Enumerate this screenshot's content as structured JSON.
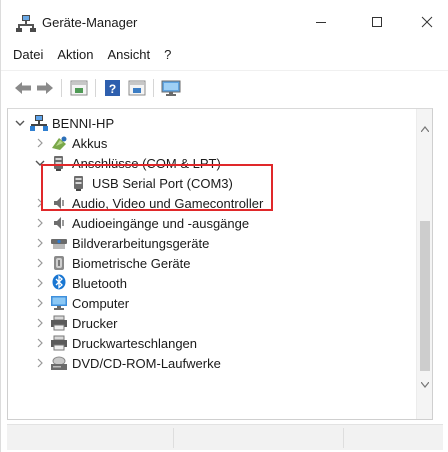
{
  "window": {
    "title": "Geräte-Manager",
    "icons": {
      "app": "device-manager-icon",
      "minimize": "minimize-icon",
      "maximize": "maximize-icon",
      "close": "close-icon"
    }
  },
  "menu": {
    "items": [
      "Datei",
      "Aktion",
      "Ansicht",
      "?"
    ]
  },
  "toolbar": {
    "buttons": [
      "back-arrow-icon",
      "forward-arrow-icon",
      "properties-icon",
      "help-icon",
      "update-driver-icon",
      "scan-hardware-icon"
    ]
  },
  "tree": {
    "root": {
      "label": "BENNI-HP",
      "expanded": true,
      "icon": "computer-icon"
    },
    "items": [
      {
        "label": "Akkus",
        "icon": "battery-icon",
        "expanded": false
      },
      {
        "label": "Anschlüsse (COM & LPT)",
        "icon": "port-icon",
        "expanded": true,
        "children": [
          {
            "label": "USB Serial Port (COM3)",
            "icon": "port-icon"
          }
        ]
      },
      {
        "label": "Audio, Video und Gamecontroller",
        "icon": "speaker-icon",
        "expanded": false
      },
      {
        "label": "Audioeingänge und -ausgänge",
        "icon": "speaker-icon",
        "expanded": false
      },
      {
        "label": "Bildverarbeitungsgeräte",
        "icon": "camera-icon",
        "expanded": false
      },
      {
        "label": "Biometrische Geräte",
        "icon": "fingerprint-icon",
        "expanded": false
      },
      {
        "label": "Bluetooth",
        "icon": "bluetooth-icon",
        "expanded": false
      },
      {
        "label": "Computer",
        "icon": "monitor-icon",
        "expanded": false
      },
      {
        "label": "Drucker",
        "icon": "printer-icon",
        "expanded": false
      },
      {
        "label": "Druckwarteschlangen",
        "icon": "printer-icon",
        "expanded": false
      },
      {
        "label": "DVD/CD-ROM-Laufwerke",
        "icon": "disc-drive-icon",
        "expanded": false
      }
    ]
  },
  "colors": {
    "highlight_border": "#e0282a",
    "bluetooth_blue": "#1976d2",
    "root_icon_blue": "#2f7fd0"
  }
}
